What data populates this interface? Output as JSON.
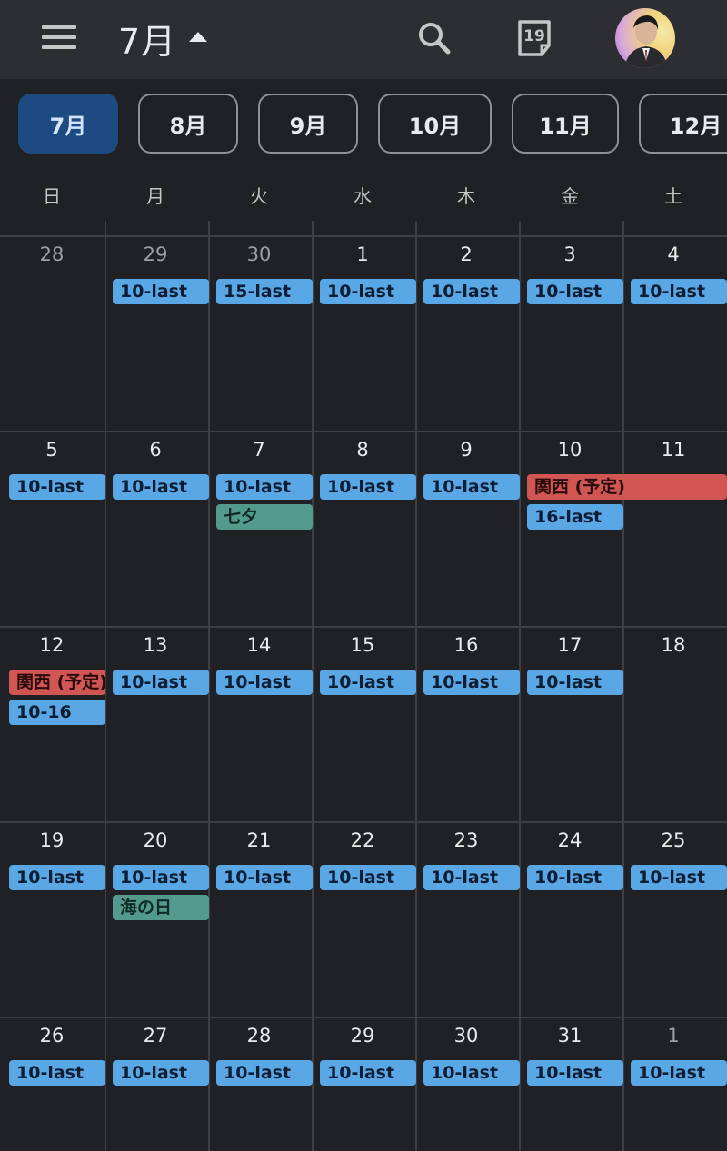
{
  "header": {
    "month_title": "7月",
    "today_badge": "19"
  },
  "month_chips": [
    {
      "label": "7月",
      "active": true
    },
    {
      "label": "8月"
    },
    {
      "label": "9月"
    },
    {
      "label": "10月"
    },
    {
      "label": "11月"
    },
    {
      "label": "12月"
    }
  ],
  "weekdays": [
    "日",
    "月",
    "火",
    "水",
    "木",
    "金",
    "土"
  ],
  "weeks": [
    {
      "days": [
        {
          "num": "28",
          "other": true,
          "events": []
        },
        {
          "num": "29",
          "other": true,
          "events": [
            {
              "label": "10-last",
              "color": "blue"
            }
          ]
        },
        {
          "num": "30",
          "other": true,
          "events": [
            {
              "label": "15-last",
              "color": "blue"
            }
          ]
        },
        {
          "num": "1",
          "events": [
            {
              "label": "10-last",
              "color": "blue"
            }
          ]
        },
        {
          "num": "2",
          "events": [
            {
              "label": "10-last",
              "color": "blue"
            }
          ]
        },
        {
          "num": "3",
          "events": [
            {
              "label": "10-last",
              "color": "blue"
            }
          ]
        },
        {
          "num": "4",
          "events": [
            {
              "label": "10-last",
              "color": "blue"
            }
          ]
        }
      ]
    },
    {
      "days": [
        {
          "num": "5",
          "events": [
            {
              "label": "10-last",
              "color": "blue"
            }
          ]
        },
        {
          "num": "6",
          "events": [
            {
              "label": "10-last",
              "color": "blue"
            }
          ]
        },
        {
          "num": "7",
          "events": [
            {
              "label": "10-last",
              "color": "blue"
            },
            {
              "label": "七夕",
              "color": "green"
            }
          ]
        },
        {
          "num": "8",
          "events": [
            {
              "label": "10-last",
              "color": "blue"
            }
          ]
        },
        {
          "num": "9",
          "events": [
            {
              "label": "10-last",
              "color": "blue"
            }
          ]
        },
        {
          "num": "10",
          "events": [
            {
              "label": "関西 (予定)",
              "color": "red",
              "span": 2
            },
            {
              "label": "16-last",
              "color": "blue"
            }
          ]
        },
        {
          "num": "11",
          "events": []
        }
      ]
    },
    {
      "days": [
        {
          "num": "12",
          "events": [
            {
              "label": "関西 (予定)",
              "color": "red"
            },
            {
              "label": "10-16",
              "color": "blue"
            }
          ]
        },
        {
          "num": "13",
          "events": [
            {
              "label": "10-last",
              "color": "blue"
            }
          ]
        },
        {
          "num": "14",
          "events": [
            {
              "label": "10-last",
              "color": "blue"
            }
          ]
        },
        {
          "num": "15",
          "events": [
            {
              "label": "10-last",
              "color": "blue"
            }
          ]
        },
        {
          "num": "16",
          "events": [
            {
              "label": "10-last",
              "color": "blue"
            }
          ]
        },
        {
          "num": "17",
          "events": [
            {
              "label": "10-last",
              "color": "blue"
            }
          ]
        },
        {
          "num": "18",
          "events": []
        }
      ]
    },
    {
      "days": [
        {
          "num": "19",
          "events": [
            {
              "label": "10-last",
              "color": "blue"
            }
          ]
        },
        {
          "num": "20",
          "events": [
            {
              "label": "10-last",
              "color": "blue"
            },
            {
              "label": "海の日",
              "color": "green"
            }
          ]
        },
        {
          "num": "21",
          "events": [
            {
              "label": "10-last",
              "color": "blue"
            }
          ]
        },
        {
          "num": "22",
          "events": [
            {
              "label": "10-last",
              "color": "blue"
            }
          ]
        },
        {
          "num": "23",
          "events": [
            {
              "label": "10-last",
              "color": "blue"
            }
          ]
        },
        {
          "num": "24",
          "events": [
            {
              "label": "10-last",
              "color": "blue"
            }
          ]
        },
        {
          "num": "25",
          "events": [
            {
              "label": "10-last",
              "color": "blue"
            }
          ]
        }
      ]
    },
    {
      "days": [
        {
          "num": "26",
          "events": [
            {
              "label": "10-last",
              "color": "blue"
            }
          ]
        },
        {
          "num": "27",
          "events": [
            {
              "label": "10-last",
              "color": "blue"
            }
          ]
        },
        {
          "num": "28",
          "events": [
            {
              "label": "10-last",
              "color": "blue"
            }
          ]
        },
        {
          "num": "29",
          "events": [
            {
              "label": "10-last",
              "color": "blue"
            }
          ]
        },
        {
          "num": "30",
          "events": [
            {
              "label": "10-last",
              "color": "blue"
            }
          ]
        },
        {
          "num": "31",
          "events": [
            {
              "label": "10-last",
              "color": "blue"
            }
          ]
        },
        {
          "num": "1",
          "other": true,
          "events": [
            {
              "label": "10-last",
              "color": "blue"
            }
          ]
        }
      ]
    }
  ]
}
